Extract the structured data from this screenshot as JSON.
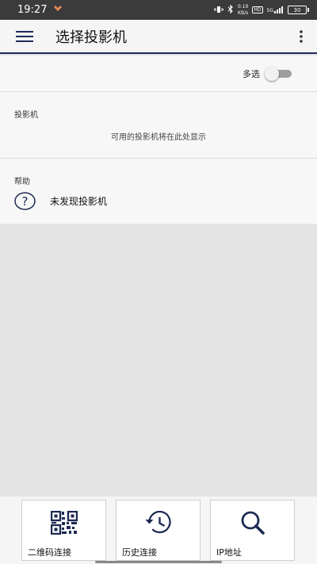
{
  "status_bar": {
    "time": "19:27",
    "network_speed_top": "0.10",
    "network_speed_bottom": "KB/s",
    "hd_label": "HD",
    "signal_label": "5G",
    "battery": "30"
  },
  "app_bar": {
    "title": "选择投影机"
  },
  "multi_select": {
    "label": "多选",
    "enabled": false
  },
  "projector_section": {
    "title": "投影机",
    "empty_message": "可用的投影机将在此处显示"
  },
  "help_section": {
    "title": "帮助",
    "item_label": "未发现投影机"
  },
  "bottom_nav": [
    {
      "label": "二维码连接",
      "icon": "qr-code-icon"
    },
    {
      "label": "历史连接",
      "icon": "history-icon"
    },
    {
      "label": "IP地址",
      "icon": "search-icon"
    }
  ],
  "colors": {
    "accent": "#1f2d5c",
    "icon": "#1c2a52"
  }
}
